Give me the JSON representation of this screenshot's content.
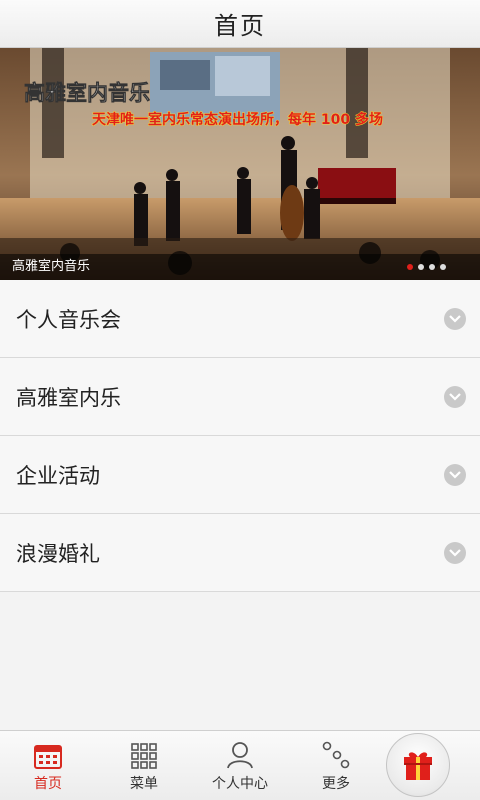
{
  "header": {
    "title": "首页"
  },
  "banner": {
    "caption": "高雅室内音乐",
    "headline": "高雅室内音乐",
    "tagline": "天津唯一室内乐常态演出场所，每年 100 多场",
    "slide_count": 4,
    "active_slide": 1
  },
  "menu": {
    "items": [
      {
        "label": "个人音乐会",
        "icon": "chevron-down-icon"
      },
      {
        "label": "高雅室内乐",
        "icon": "chevron-down-icon"
      },
      {
        "label": "企业活动",
        "icon": "chevron-down-icon"
      },
      {
        "label": "浪漫婚礼",
        "icon": "chevron-down-icon"
      }
    ]
  },
  "tabbar": {
    "tabs": [
      {
        "label": "首页",
        "icon": "home-calendar-icon",
        "active": true
      },
      {
        "label": "菜单",
        "icon": "grid-menu-icon",
        "active": false
      },
      {
        "label": "个人中心",
        "icon": "person-icon",
        "active": false
      },
      {
        "label": "更多",
        "icon": "more-dots-icon",
        "active": false
      }
    ],
    "gift_icon": "gift-icon"
  },
  "colors": {
    "accent": "#d7291f",
    "banner_text_red": "#e0201b",
    "banner_text_yellow": "#ffe02a"
  }
}
